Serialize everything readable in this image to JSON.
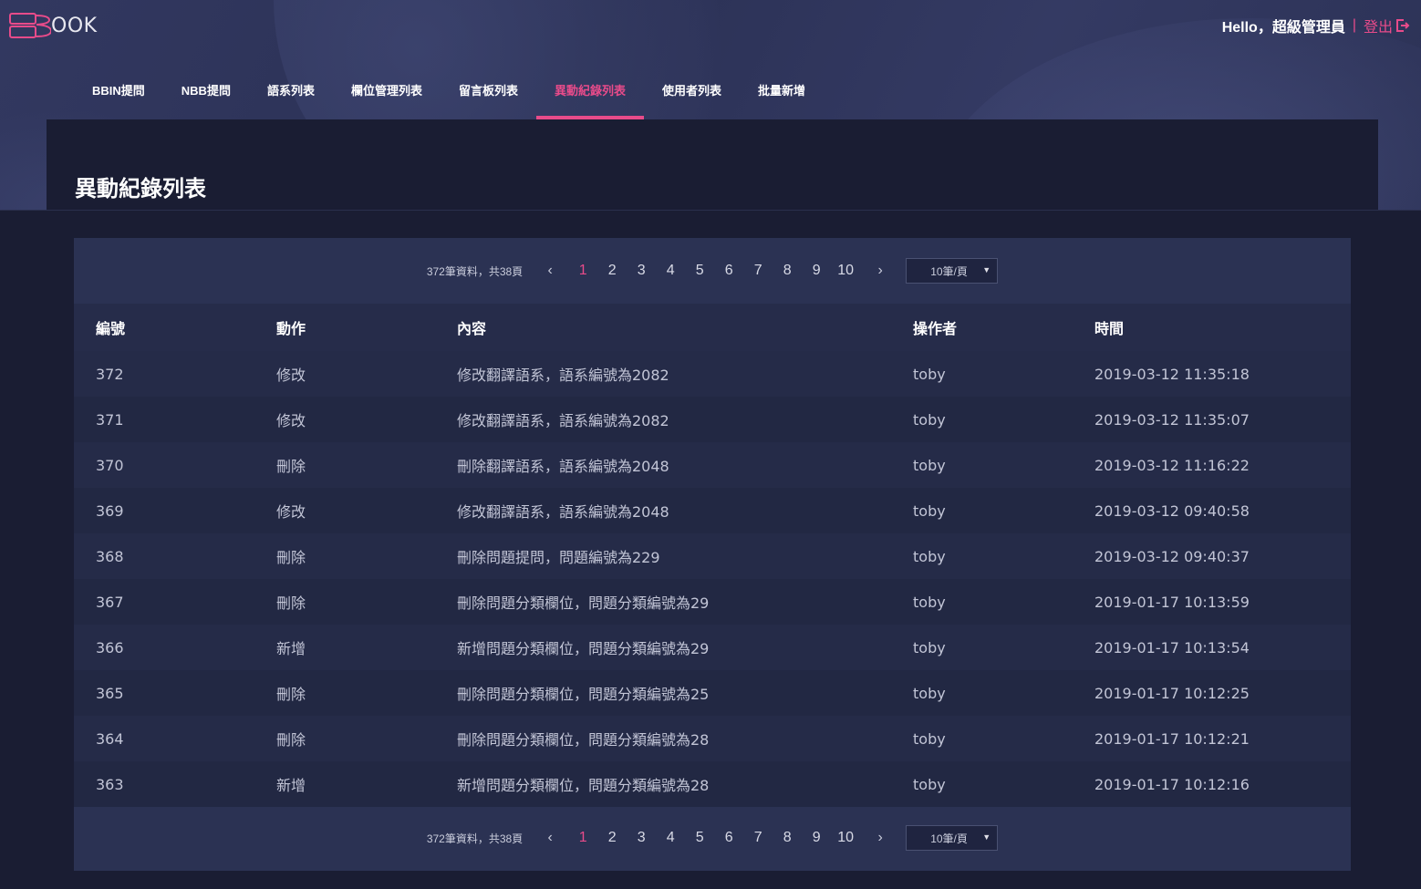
{
  "app": {
    "logo_text": "OOK",
    "greeting": "Hello，超級管理員",
    "separator": "|",
    "logout_label": "登出"
  },
  "nav": {
    "items": [
      {
        "label": "BBIN提問",
        "active": false
      },
      {
        "label": "NBB提問",
        "active": false
      },
      {
        "label": "語系列表",
        "active": false
      },
      {
        "label": "欄位管理列表",
        "active": false
      },
      {
        "label": "留言板列表",
        "active": false
      },
      {
        "label": "異動紀錄列表",
        "active": true
      },
      {
        "label": "使用者列表",
        "active": false
      },
      {
        "label": "批量新增",
        "active": false
      }
    ]
  },
  "page": {
    "title": "異動紀錄列表"
  },
  "pager": {
    "summary": "372筆資料，共38頁",
    "prev": "‹",
    "next": "›",
    "pages": [
      "1",
      "2",
      "3",
      "4",
      "5",
      "6",
      "7",
      "8",
      "9",
      "10"
    ],
    "current": "1",
    "page_size": "10筆/頁"
  },
  "table": {
    "headers": [
      "編號",
      "動作",
      "內容",
      "操作者",
      "時間"
    ],
    "rows": [
      [
        "372",
        "修改",
        "修改翻譯語系，語系編號為2082",
        "toby",
        "2019-03-12 11:35:18"
      ],
      [
        "371",
        "修改",
        "修改翻譯語系，語系編號為2082",
        "toby",
        "2019-03-12 11:35:07"
      ],
      [
        "370",
        "刪除",
        "刪除翻譯語系，語系編號為2048",
        "toby",
        "2019-03-12 11:16:22"
      ],
      [
        "369",
        "修改",
        "修改翻譯語系，語系編號為2048",
        "toby",
        "2019-03-12 09:40:58"
      ],
      [
        "368",
        "刪除",
        "刪除問題提問，問題編號為229",
        "toby",
        "2019-03-12 09:40:37"
      ],
      [
        "367",
        "刪除",
        "刪除問題分類欄位，問題分類編號為29",
        "toby",
        "2019-01-17 10:13:59"
      ],
      [
        "366",
        "新增",
        "新增問題分類欄位，問題分類編號為29",
        "toby",
        "2019-01-17 10:13:54"
      ],
      [
        "365",
        "刪除",
        "刪除問題分類欄位，問題分類編號為25",
        "toby",
        "2019-01-17 10:12:25"
      ],
      [
        "364",
        "刪除",
        "刪除問題分類欄位，問題分類編號為28",
        "toby",
        "2019-01-17 10:12:21"
      ],
      [
        "363",
        "新增",
        "新增問題分類欄位，問題分類編號為28",
        "toby",
        "2019-01-17 10:12:16"
      ]
    ]
  },
  "colors": {
    "accent": "#e84b8a",
    "hero": "#2f3559",
    "card": "#2b3253",
    "background": "#1a1d33"
  },
  "icons": {
    "logo": "book-logo-icon",
    "logout": "logout-icon",
    "prev": "chevron-left-icon",
    "next": "chevron-right-icon",
    "select": "caret-down-icon"
  }
}
